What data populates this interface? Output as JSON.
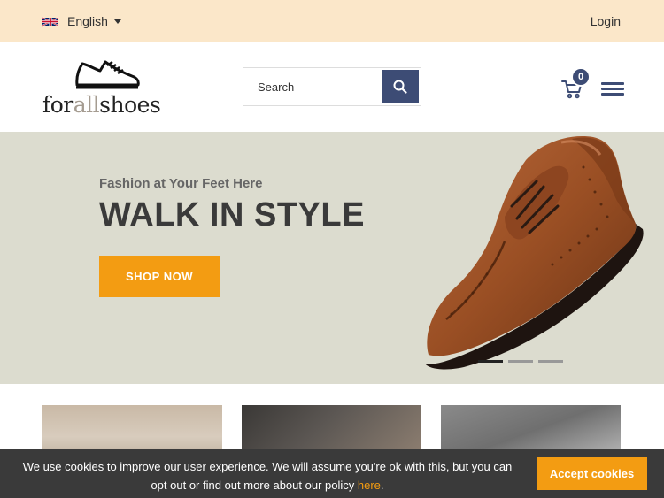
{
  "topbar": {
    "language_label": "English",
    "language_flag_icon": "uk-flag-icon",
    "login_label": "Login",
    "background_color": "#fbe7c9"
  },
  "header": {
    "logo_text_dark_1": "for",
    "logo_text_light": "all",
    "logo_text_dark_2": "shoes",
    "logo_icon": "sneaker-outline-icon",
    "search_placeholder": "Search",
    "search_icon": "search-icon",
    "cart_icon": "cart-icon",
    "cart_count": "0",
    "menu_icon": "hamburger-menu-icon"
  },
  "hero": {
    "subtitle": "Fashion at Your Feet Here",
    "title": "WALK IN STYLE",
    "cta_label": "SHOP NOW",
    "background_color": "#dcdccf",
    "accent_color": "#f39c12",
    "slide_count": 3,
    "active_slide": 1
  },
  "cookie": {
    "text_before": "We use cookies to improve our user experience. We will assume you're ok with this, but you can opt out or find out more about our policy ",
    "link_label": "here",
    "text_after": ".",
    "accept_label": "Accept cookies"
  },
  "colors": {
    "brand_navy": "#3d4c75",
    "brand_orange": "#f39c12"
  }
}
